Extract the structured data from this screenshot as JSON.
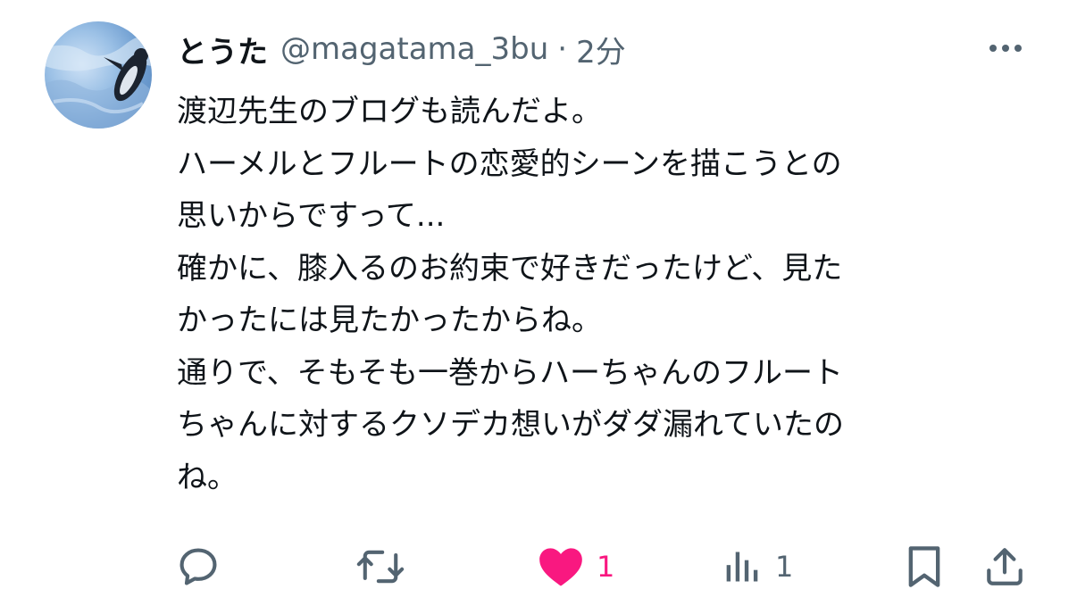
{
  "tweet": {
    "display_name": "とうた",
    "handle": "@magatama_3bu",
    "separator": "·",
    "time": "2分",
    "lines": [
      "渡辺先生のブログも読んだよ。",
      "ハーメルとフルートの恋愛的シーンを描こうとの",
      "思いからですって...",
      "確かに、膝入るのお約束で好きだったけど、見た",
      "かったには見たかったからね。",
      "通りで、そもそも一巻からハーちゃんのフルート",
      "ちゃんに対するクソデカ想いがダダ漏れていたの",
      "ね。"
    ],
    "avatar_icon": "penguin-photo",
    "more_icon": "more-dots-icon"
  },
  "actions": {
    "reply": {
      "icon": "reply-icon",
      "count": ""
    },
    "retweet": {
      "icon": "retweet-icon",
      "count": ""
    },
    "like": {
      "icon": "heart-icon",
      "count": "1",
      "liked": true,
      "color": "#f91880"
    },
    "views": {
      "icon": "views-icon",
      "count": "1"
    },
    "bookmark": {
      "icon": "bookmark-icon"
    },
    "share": {
      "icon": "share-icon"
    }
  },
  "colors": {
    "text": "#0f1419",
    "secondary": "#536471",
    "like": "#f91880"
  }
}
